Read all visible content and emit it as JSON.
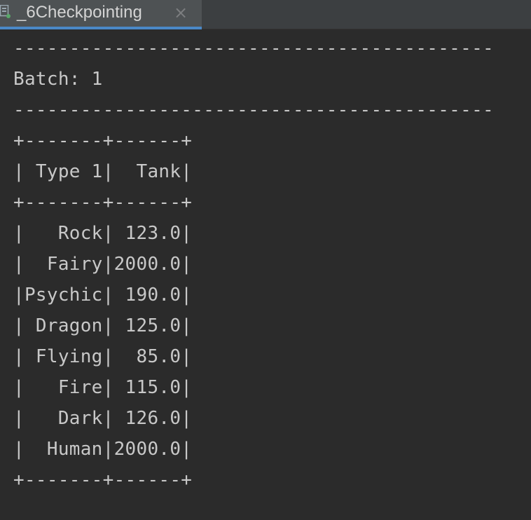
{
  "tab": {
    "title": "_6Checkpointing",
    "close_glyph": "×",
    "icon": "console-icon",
    "active_color": "#4a88c7"
  },
  "console": {
    "lines": [
      "-------------------------------------------",
      "Batch: 1",
      "-------------------------------------------",
      "+-------+------+",
      "| Type 1|  Tank|",
      "+-------+------+",
      "|   Rock| 123.0|",
      "|  Fairy|2000.0|",
      "|Psychic| 190.0|",
      "| Dragon| 125.0|",
      "| Flying|  85.0|",
      "|   Fire| 115.0|",
      "|   Dark| 126.0|",
      "|  Human|2000.0|",
      "+-------+------+"
    ]
  }
}
